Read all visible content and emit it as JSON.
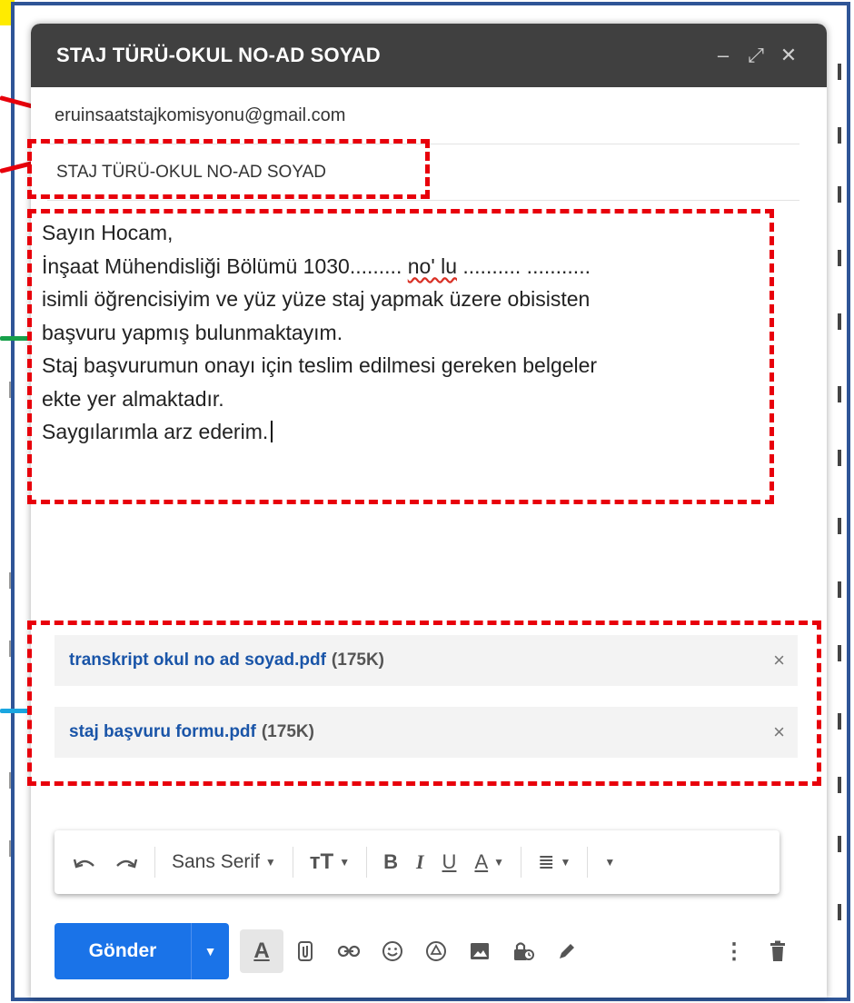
{
  "compose": {
    "title": "STAJ TÜRÜ-OKUL NO-AD SOYAD",
    "to": "eruinsaatstajkomisyonu@gmail.com",
    "subject": "STAJ TÜRÜ-OKUL NO-AD SOYAD",
    "body": {
      "line1": "Sayın Hocam,",
      "line2_pre": "İnşaat Mühendisliği Bölümü 1030......... ",
      "line2_spell": "no' lu",
      "line2_post": " .......... ...........",
      "line3": "isimli öğrencisiyim ve yüz yüze staj yapmak üzere obisisten",
      "line4": "başvuru yapmış bulunmaktayım.",
      "line5": "Staj başvurumun onayı için teslim edilmesi gereken belgeler",
      "line6": "ekte yer almaktadır.",
      "line7": "Saygılarımla arz ederim."
    },
    "attachments": [
      {
        "name": "transkript okul no ad soyad.pdf",
        "size": "(175K)"
      },
      {
        "name": "staj başvuru formu.pdf",
        "size": "(175K)"
      }
    ],
    "format": {
      "font": "Sans Serif"
    },
    "send_label": "Gönder"
  },
  "colors": {
    "titlebar": "#404040",
    "send": "#1a73e8",
    "annotation_red": "#e8000b",
    "frame_blue": "#2f5597",
    "attachment_link": "#1a55a8"
  },
  "icons": [
    "minimize-icon",
    "expand-icon",
    "close-icon",
    "undo-icon",
    "redo-icon",
    "text-size-icon",
    "bold-icon",
    "italic-icon",
    "underline-icon",
    "text-color-icon",
    "align-icon",
    "more-formatting-icon",
    "formatting-toggle-icon",
    "attach-file-icon",
    "link-icon",
    "emoji-icon",
    "drive-icon",
    "photo-icon",
    "confidential-icon",
    "signature-icon",
    "more-options-icon",
    "trash-icon"
  ]
}
